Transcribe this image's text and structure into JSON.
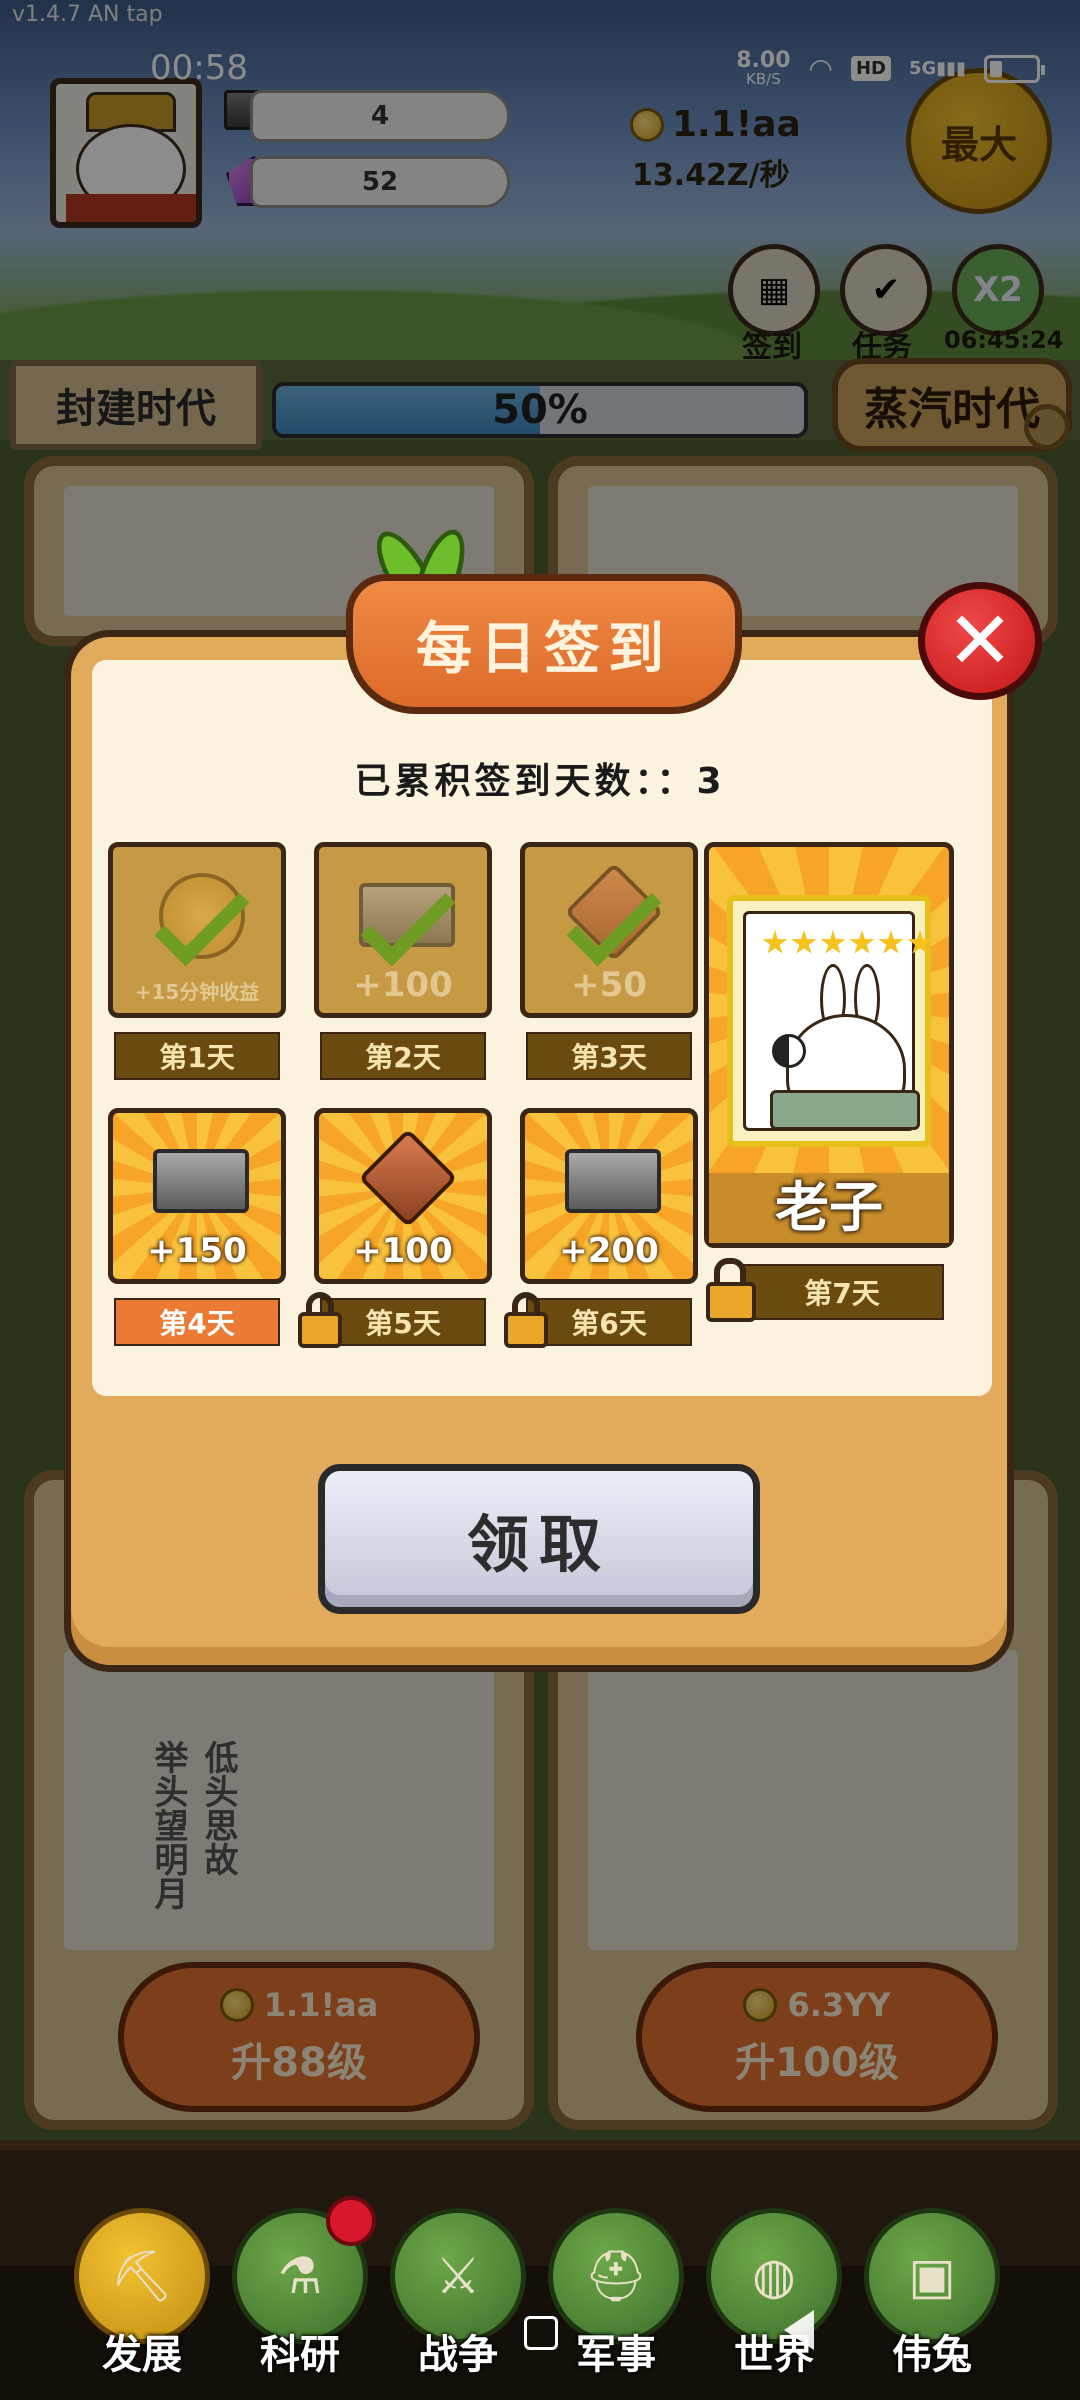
{
  "app": {
    "version": "v1.4.7 AN tap"
  },
  "status_bar": {
    "time": "00:58",
    "net_speed_value": "8.00",
    "net_speed_unit": "KB/S",
    "hd_label": "HD",
    "signal_label": "5G"
  },
  "hud": {
    "ingot_count": "4",
    "gem_count": "52",
    "gold_total": "1.1!aa",
    "gold_rate": "13.42Z/秒",
    "max_button": "最大",
    "checkin_label": "签到",
    "tasks_label": "任务",
    "x2_label": "X2",
    "x2_timer": "06:45:24"
  },
  "era": {
    "current": "封建时代",
    "progress_text": "50%",
    "progress_percent": 50,
    "next": "蒸汽时代"
  },
  "dialog": {
    "title": "每日签到",
    "close_symbol": "✕",
    "accumulated_text": "已累积签到天数：：3",
    "claim_button": "领取",
    "days": [
      {
        "label": "第1天",
        "reward": "+15分钟收益",
        "state": "claimed",
        "icon": "coin-icon"
      },
      {
        "label": "第2天",
        "reward": "+100",
        "state": "claimed",
        "icon": "ingot-icon"
      },
      {
        "label": "第3天",
        "reward": "+50",
        "state": "claimed",
        "icon": "book-icon"
      },
      {
        "label": "第4天",
        "reward": "+150",
        "state": "current",
        "icon": "ingot-icon"
      },
      {
        "label": "第5天",
        "reward": "+100",
        "state": "locked",
        "icon": "book-icon"
      },
      {
        "label": "第6天",
        "reward": "+200",
        "state": "locked",
        "icon": "ingot-icon"
      },
      {
        "label": "第7天",
        "reward": "老子",
        "state": "locked",
        "icon": "rabbit-portrait",
        "stars": 6
      }
    ]
  },
  "background": {
    "stele_left": "低头思故",
    "stele_right": "举头望明月",
    "card_left_cost": "1.1!aa",
    "card_left_upgrade": "升88级",
    "card_right_cost": "6.3YY",
    "card_right_upgrade": "升100级"
  },
  "nav": {
    "items": [
      {
        "label": "发展",
        "icon": "shovel-icon"
      },
      {
        "label": "科研",
        "icon": "flask-icon"
      },
      {
        "label": "战争",
        "icon": "swords-icon"
      },
      {
        "label": "军事",
        "icon": "helmet-icon"
      },
      {
        "label": "世界",
        "icon": "globe-icon"
      },
      {
        "label": "伟兔",
        "icon": "portrait-frame-icon"
      }
    ]
  },
  "colors": {
    "dialog_frame": "#e2ab5b",
    "title_banner": "#dc6a29",
    "close_button": "#c21616",
    "current_day": "#ea7a34",
    "progress_fill": "#3e8ac0"
  }
}
